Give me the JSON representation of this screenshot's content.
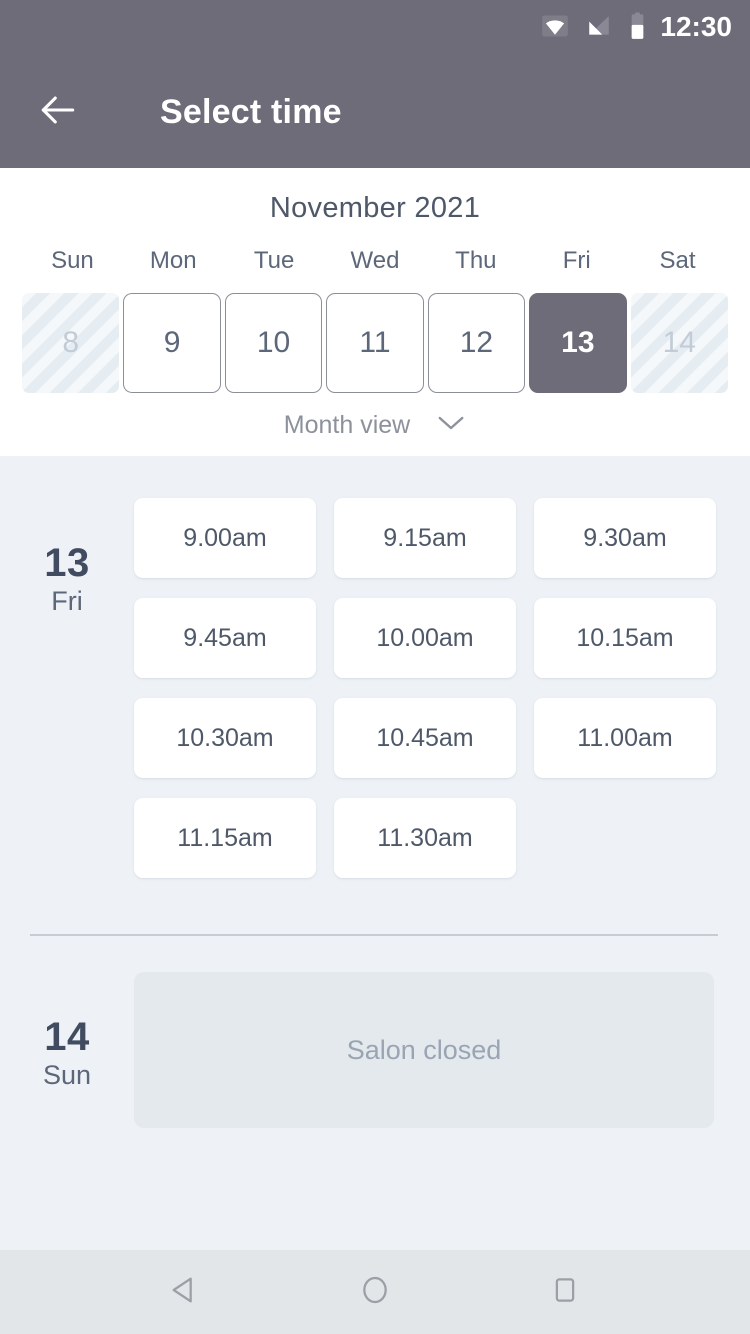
{
  "status_bar": {
    "time": "12:30",
    "icons": [
      "wifi-icon",
      "cellular-signal-icon",
      "battery-icon"
    ]
  },
  "app_bar": {
    "back_icon": "arrow-left-icon",
    "title": "Select time",
    "background_color": "#6e6c78"
  },
  "calendar": {
    "month_title": "November 2021",
    "weekdays": [
      "Sun",
      "Mon",
      "Tue",
      "Wed",
      "Thu",
      "Fri",
      "Sat"
    ],
    "days": [
      {
        "number": "8",
        "state": "disabled"
      },
      {
        "number": "9",
        "state": "available"
      },
      {
        "number": "10",
        "state": "available"
      },
      {
        "number": "11",
        "state": "available"
      },
      {
        "number": "12",
        "state": "available"
      },
      {
        "number": "13",
        "state": "selected"
      },
      {
        "number": "14",
        "state": "disabled"
      }
    ],
    "month_view": {
      "label": "Month view",
      "icon": "chevron-down-icon"
    },
    "selected_color": "#6e6c78",
    "text_color": "#5d677a"
  },
  "slots": {
    "groups": [
      {
        "day_number": "13",
        "day_name": "Fri",
        "times": [
          "9.00am",
          "9.15am",
          "9.30am",
          "9.45am",
          "10.00am",
          "10.15am",
          "10.30am",
          "10.45am",
          "11.00am",
          "11.15am",
          "11.30am"
        ]
      }
    ],
    "closed_group": {
      "day_number": "14",
      "day_name": "Sun",
      "message": "Salon closed"
    },
    "background_color": "#eef2f7",
    "chip_color": "#ffffff",
    "closed_panel_color": "#e4e9ee"
  },
  "nav_bar": {
    "buttons": [
      "back-triangle-icon",
      "home-circle-icon",
      "recents-square-icon"
    ],
    "background_color": "#e3e6e9"
  }
}
